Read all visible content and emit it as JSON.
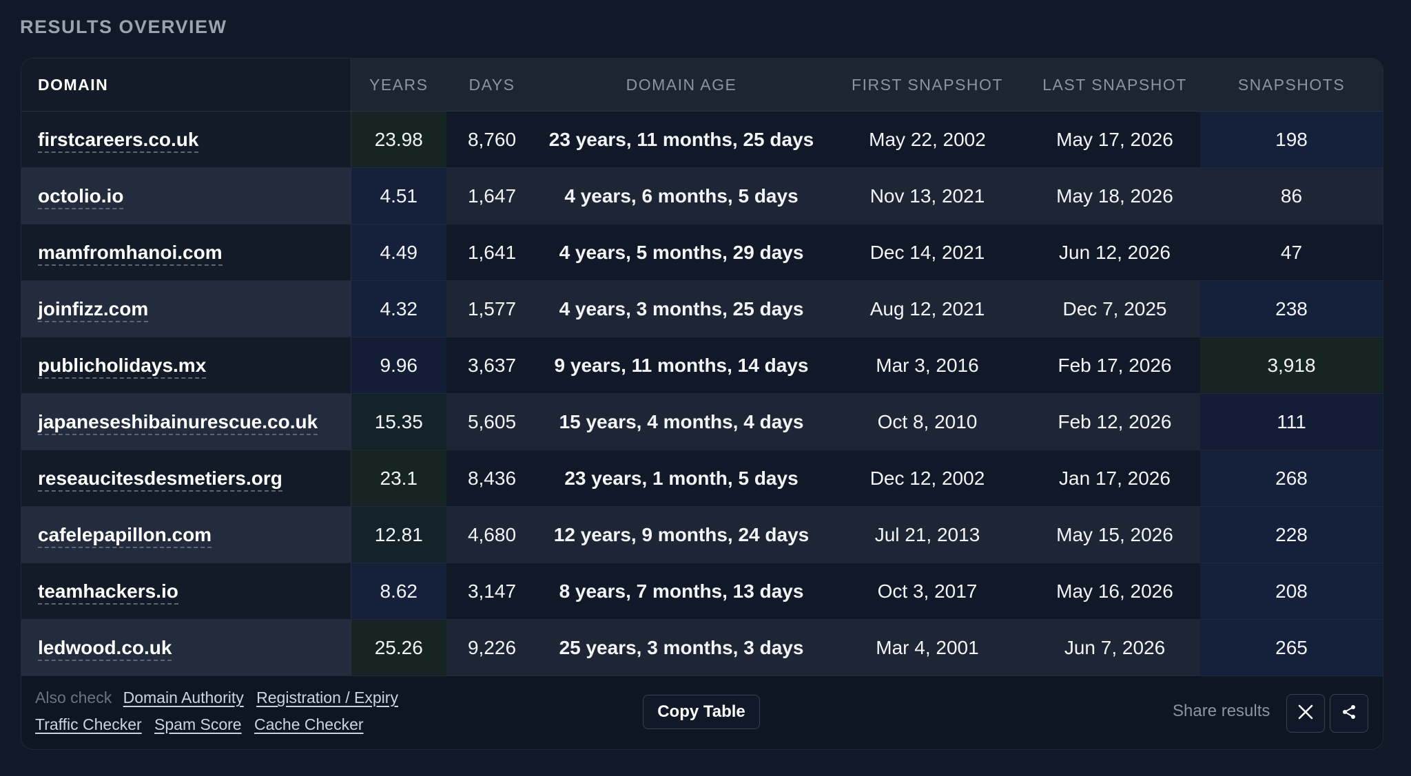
{
  "section_title": "RESULTS OVERVIEW",
  "table": {
    "columns": [
      "DOMAIN",
      "YEARS",
      "DAYS",
      "DOMAIN AGE",
      "FIRST SNAPSHOT",
      "LAST SNAPSHOT",
      "SNAPSHOTS"
    ],
    "rows": [
      {
        "domain": "firstcareers.co.uk",
        "years": "23.98",
        "days": "8,760",
        "age": "23 years, 11 months, 25 days",
        "first": "May 22, 2002",
        "last": "May 17, 2026",
        "snapshots": "198"
      },
      {
        "domain": "octolio.io",
        "years": "4.51",
        "days": "1,647",
        "age": "4 years, 6 months, 5 days",
        "first": "Nov 13, 2021",
        "last": "May 18, 2026",
        "snapshots": "86"
      },
      {
        "domain": "mamfromhanoi.com",
        "years": "4.49",
        "days": "1,641",
        "age": "4 years, 5 months, 29 days",
        "first": "Dec 14, 2021",
        "last": "Jun 12, 2026",
        "snapshots": "47"
      },
      {
        "domain": "joinfizz.com",
        "years": "4.32",
        "days": "1,577",
        "age": "4 years, 3 months, 25 days",
        "first": "Aug 12, 2021",
        "last": "Dec 7, 2025",
        "snapshots": "238"
      },
      {
        "domain": "publicholidays.mx",
        "years": "9.96",
        "days": "3,637",
        "age": "9 years, 11 months, 14 days",
        "first": "Mar 3, 2016",
        "last": "Feb 17, 2026",
        "snapshots": "3,918"
      },
      {
        "domain": "japaneseshibainurescue.co.uk",
        "years": "15.35",
        "days": "5,605",
        "age": "15 years, 4 months, 4 days",
        "first": "Oct 8, 2010",
        "last": "Feb 12, 2026",
        "snapshots": "111"
      },
      {
        "domain": "reseaucitesdesmetiers.org",
        "years": "23.1",
        "days": "8,436",
        "age": "23 years, 1 month, 5 days",
        "first": "Dec 12, 2002",
        "last": "Jan 17, 2026",
        "snapshots": "268"
      },
      {
        "domain": "cafelepapillon.com",
        "years": "12.81",
        "days": "4,680",
        "age": "12 years, 9 months, 24 days",
        "first": "Jul 21, 2013",
        "last": "May 15, 2026",
        "snapshots": "228"
      },
      {
        "domain": "teamhackers.io",
        "years": "8.62",
        "days": "3,147",
        "age": "8 years, 7 months, 13 days",
        "first": "Oct 3, 2017",
        "last": "May 16, 2026",
        "snapshots": "208"
      },
      {
        "domain": "ledwood.co.uk",
        "years": "25.26",
        "days": "9,226",
        "age": "25 years, 3 months, 3 days",
        "first": "Mar 4, 2001",
        "last": "Jun 7, 2026",
        "snapshots": "265"
      }
    ]
  },
  "footer": {
    "also_check_label": "Also check",
    "links": [
      "Domain Authority",
      "Registration / Expiry",
      "Traffic Checker",
      "Spam Score",
      "Cache Checker"
    ],
    "copy_button": "Copy Table",
    "share_label": "Share results",
    "share_icons": [
      "x-logo-icon",
      "share-icon"
    ]
  },
  "colors": {
    "background": "#111827",
    "header_bg": "#1d2533",
    "highlight_blue": "#15203b",
    "highlight_green": "#172424"
  }
}
